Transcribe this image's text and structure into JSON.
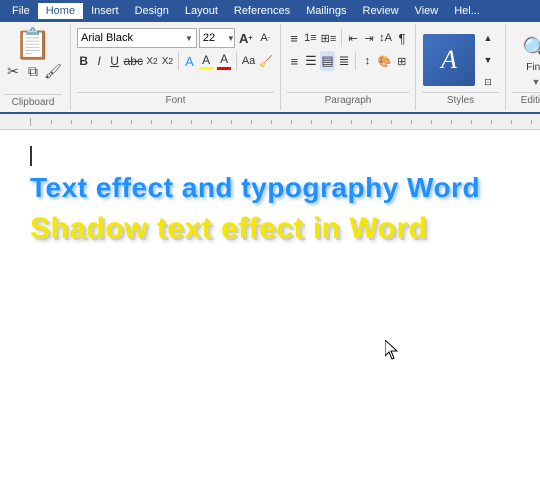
{
  "menubar": {
    "items": [
      {
        "id": "file",
        "label": "File"
      },
      {
        "id": "home",
        "label": "Home"
      },
      {
        "id": "insert",
        "label": "Insert"
      },
      {
        "id": "design",
        "label": "Design"
      },
      {
        "id": "layout",
        "label": "Layout"
      },
      {
        "id": "references",
        "label": "References"
      },
      {
        "id": "mailings",
        "label": "Mailings"
      },
      {
        "id": "review",
        "label": "Review"
      },
      {
        "id": "view",
        "label": "View"
      },
      {
        "id": "help",
        "label": "Hel..."
      }
    ],
    "active": "home"
  },
  "ribbon": {
    "font": {
      "name": "Arial Black",
      "size": "22"
    },
    "sections": {
      "clipboard": "Clipboard",
      "font": "Font",
      "paragraph": "Paragraph",
      "styles": "Styles",
      "editing": "Editing"
    }
  },
  "document": {
    "line1": "Text effect and typography Word",
    "line2": "Shadow text effect in Word"
  },
  "editing_label": "Editing",
  "styles_label": "Styles",
  "paragraph_label": "Paragraph",
  "font_label": "Font",
  "clipboard_label": "Clipboard"
}
